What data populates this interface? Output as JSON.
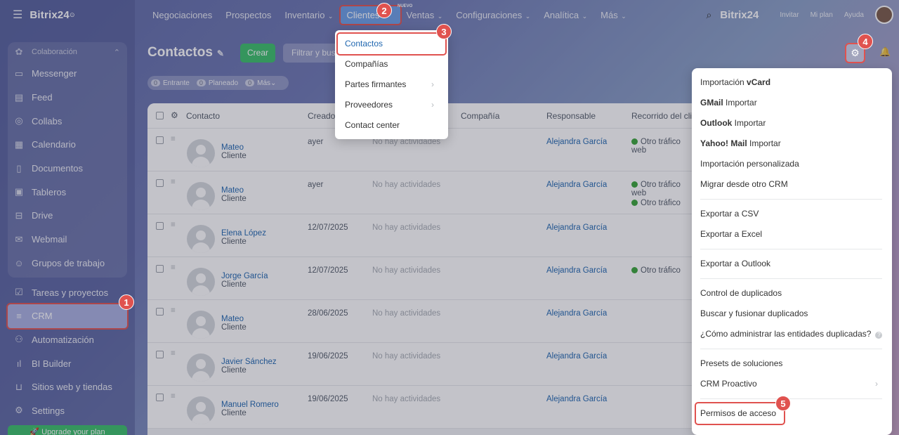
{
  "app": {
    "logo": "Bitrix24",
    "brand_top": "Bitrix24"
  },
  "sidebar": {
    "group_label": "Colaboración",
    "items": [
      {
        "label": "Messenger",
        "icon": "chat-icon"
      },
      {
        "label": "Feed",
        "icon": "feed-icon"
      },
      {
        "label": "Collabs",
        "icon": "collabs-icon"
      },
      {
        "label": "Calendario",
        "icon": "calendar-icon"
      },
      {
        "label": "Documentos",
        "icon": "document-icon"
      },
      {
        "label": "Tableros",
        "icon": "board-icon"
      },
      {
        "label": "Drive",
        "icon": "drive-icon"
      },
      {
        "label": "Webmail",
        "icon": "mail-icon"
      },
      {
        "label": "Grupos de trabajo",
        "icon": "group-icon"
      }
    ],
    "solo": [
      {
        "label": "Tareas y proyectos",
        "icon": "task-icon"
      },
      {
        "label": "CRM",
        "icon": "crm-icon"
      },
      {
        "label": "Automatización",
        "icon": "automation-icon"
      },
      {
        "label": "BI Builder",
        "icon": "bi-icon"
      },
      {
        "label": "Sitios web y tiendas",
        "icon": "sites-icon"
      },
      {
        "label": "Settings",
        "icon": "gear-icon"
      }
    ],
    "upgrade": "Upgrade your plan"
  },
  "topnav": {
    "items": [
      "Negociaciones",
      "Prospectos",
      "Inventario",
      "Clientes",
      "Ventas",
      "Configuraciones",
      "Analítica",
      "Más"
    ],
    "nuevo": "NUEVO",
    "invite": "Invitar",
    "plan": "Mi plan",
    "help": "Ayuda"
  },
  "page": {
    "title": "Contactos",
    "create": "Crear",
    "filter_placeholder": "Filtrar y buscar",
    "counters": [
      {
        "num": "0",
        "label": "Entrante"
      },
      {
        "num": "0",
        "label": "Planeado"
      },
      {
        "num": "0",
        "label": "Más"
      }
    ]
  },
  "table": {
    "headers": [
      "Contacto",
      "Creado",
      "Compañía",
      "Responsable",
      "Recorrido del cli"
    ],
    "rows": [
      {
        "name": "Mateo",
        "type": "Cliente",
        "created": "ayer",
        "activity": "No hay actividades",
        "owner": "Alejandra García",
        "journey": [
          "Otro tráfico web"
        ]
      },
      {
        "name": "Mateo",
        "type": "Cliente",
        "created": "ayer",
        "activity": "No hay actividades",
        "owner": "Alejandra García",
        "journey": [
          "Otro tráfico web",
          "Otro tráfico"
        ]
      },
      {
        "name": "Elena López",
        "type": "Cliente",
        "created": "12/07/2025",
        "activity": "No hay actividades",
        "owner": "Alejandra García",
        "journey": []
      },
      {
        "name": "Jorge García",
        "type": "Cliente",
        "created": "12/07/2025",
        "activity": "No hay actividades",
        "owner": "Alejandra García",
        "journey": [
          "Otro tráfico"
        ]
      },
      {
        "name": "Mateo",
        "type": "Cliente",
        "created": "28/06/2025",
        "activity": "No hay actividades",
        "owner": "Alejandra García",
        "journey": []
      },
      {
        "name": "Javier Sánchez",
        "type": "Cliente",
        "created": "19/06/2025",
        "activity": "No hay actividades",
        "owner": "Alejandra García",
        "journey": []
      },
      {
        "name": "Manuel Romero",
        "type": "Cliente",
        "created": "19/06/2025",
        "activity": "No hay actividades",
        "owner": "Alejandra García",
        "journey": []
      }
    ]
  },
  "clientes_menu": [
    "Contactos",
    "Compañías",
    "Partes firmantes",
    "Proveedores",
    "Contact center"
  ],
  "settings_menu": {
    "import": [
      {
        "bold": "",
        "text": "Importación ",
        "bold_after": "vCard"
      },
      {
        "bold": "GMail",
        "text": " Importar",
        "bold_after": ""
      },
      {
        "bold": "Outlook",
        "text": " Importar",
        "bold_after": ""
      },
      {
        "bold": "Yahoo! Mail",
        "text": " Importar",
        "bold_after": ""
      },
      {
        "bold": "",
        "text": "Importación personalizada",
        "bold_after": ""
      },
      {
        "bold": "",
        "text": "Migrar desde otro CRM",
        "bold_after": ""
      }
    ],
    "export": [
      "Exportar a CSV",
      "Exportar a Excel"
    ],
    "export_outlook": "Exportar a Outlook",
    "duplicates": [
      "Control de duplicados",
      "Buscar y fusionar duplicados",
      "¿Cómo administrar las entidades duplicadas?"
    ],
    "solutions": [
      "Presets de soluciones",
      "CRM Proactivo"
    ],
    "access": "Permisos de acceso"
  },
  "badges": [
    "1",
    "2",
    "3",
    "4",
    "5"
  ]
}
